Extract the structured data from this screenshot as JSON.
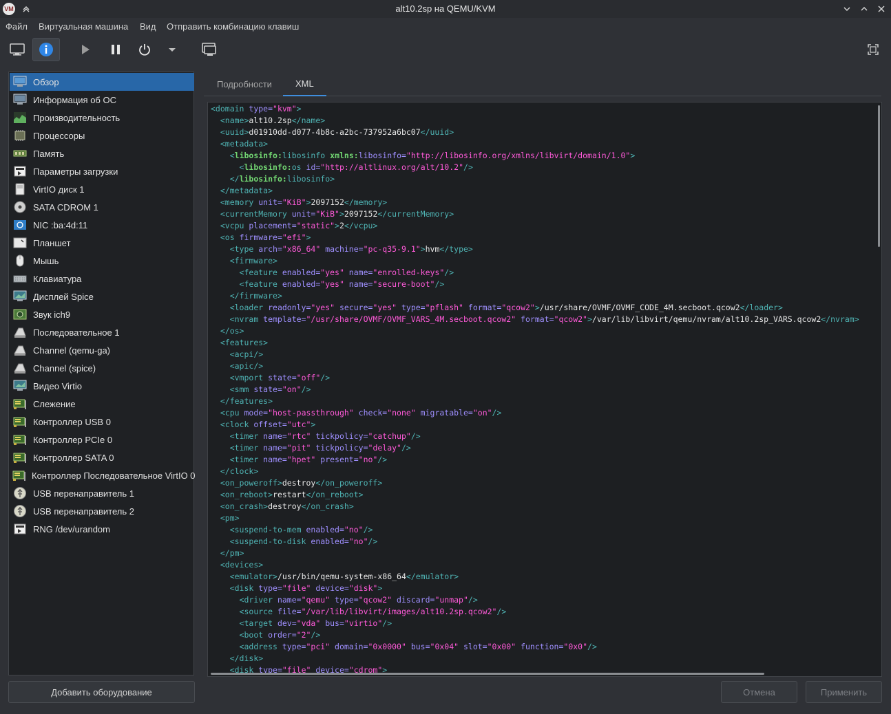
{
  "window": {
    "title": "alt10.2sp на QEMU/KVM",
    "logo_text": "VM"
  },
  "menu": [
    "Файл",
    "Виртуальная машина",
    "Вид",
    "Отправить комбинацию клавиш"
  ],
  "sidebar": {
    "items": [
      {
        "label": "Обзор",
        "icon": "overview-monitor-icon"
      },
      {
        "label": "Информация об ОС",
        "icon": "os-info-icon"
      },
      {
        "label": "Производительность",
        "icon": "performance-chart-icon"
      },
      {
        "label": "Процессоры",
        "icon": "cpu-chip-icon"
      },
      {
        "label": "Память",
        "icon": "memory-module-icon"
      },
      {
        "label": "Параметры загрузки",
        "icon": "boot-options-icon"
      },
      {
        "label": "VirtIO диск 1",
        "icon": "disk-icon"
      },
      {
        "label": "SATA CDROM 1",
        "icon": "cdrom-icon"
      },
      {
        "label": "NIC :ba:4d:11",
        "icon": "network-icon"
      },
      {
        "label": "Планшет",
        "icon": "tablet-icon"
      },
      {
        "label": "Мышь",
        "icon": "mouse-icon"
      },
      {
        "label": "Клавиатура",
        "icon": "keyboard-icon"
      },
      {
        "label": "Дисплей Spice",
        "icon": "display-icon"
      },
      {
        "label": "Звук ich9",
        "icon": "sound-icon"
      },
      {
        "label": "Последовательное 1",
        "icon": "serial-icon"
      },
      {
        "label": "Channel (qemu-ga)",
        "icon": "channel-icon"
      },
      {
        "label": "Channel (spice)",
        "icon": "channel-icon"
      },
      {
        "label": "Видео Virtio",
        "icon": "video-icon"
      },
      {
        "label": "Слежение",
        "icon": "watchdog-card-icon"
      },
      {
        "label": "Контроллер USB 0",
        "icon": "controller-card-icon"
      },
      {
        "label": "Контроллер PCIe 0",
        "icon": "controller-card-icon"
      },
      {
        "label": "Контроллер SATA 0",
        "icon": "controller-card-icon"
      },
      {
        "label": "Контроллер Последовательное VirtIO 0",
        "icon": "controller-card-icon"
      },
      {
        "label": "USB перенаправитель 1",
        "icon": "usb-redirector-icon"
      },
      {
        "label": "USB перенаправитель 2",
        "icon": "usb-redirector-icon"
      },
      {
        "label": "RNG /dev/urandom",
        "icon": "rng-icon"
      }
    ],
    "selected_index": 0
  },
  "buttons": {
    "add_hardware": "Добавить оборудование",
    "cancel": "Отмена",
    "apply": "Применить"
  },
  "tabs": [
    {
      "label": "Подробности",
      "active": false
    },
    {
      "label": "XML",
      "active": true
    }
  ],
  "xml_lines": [
    [
      [
        "t",
        "<domain "
      ],
      [
        "a",
        "type="
      ],
      [
        "v",
        "\"kvm\""
      ],
      [
        "t",
        ">"
      ]
    ],
    [
      [
        "s",
        "  "
      ],
      [
        "t",
        "<name>"
      ],
      [
        "x",
        "alt10.2sp"
      ],
      [
        "t",
        "</name>"
      ]
    ],
    [
      [
        "s",
        "  "
      ],
      [
        "t",
        "<uuid>"
      ],
      [
        "x",
        "d01910dd-d077-4b8c-a2bc-737952a6bc07"
      ],
      [
        "t",
        "</uuid>"
      ]
    ],
    [
      [
        "s",
        "  "
      ],
      [
        "t",
        "<metadata>"
      ]
    ],
    [
      [
        "s",
        "    "
      ],
      [
        "t",
        "<"
      ],
      [
        "n",
        "libosinfo:"
      ],
      [
        "t",
        "libosinfo "
      ],
      [
        "n",
        "xmlns:"
      ],
      [
        "a",
        "libosinfo="
      ],
      [
        "v",
        "\"http://libosinfo.org/xmlns/libvirt/domain/1.0\""
      ],
      [
        "t",
        ">"
      ]
    ],
    [
      [
        "s",
        "      "
      ],
      [
        "t",
        "<"
      ],
      [
        "n",
        "libosinfo:"
      ],
      [
        "t",
        "os "
      ],
      [
        "a",
        "id="
      ],
      [
        "v",
        "\"http://altlinux.org/alt/10.2\""
      ],
      [
        "t",
        "/>"
      ]
    ],
    [
      [
        "s",
        "    "
      ],
      [
        "t",
        "</"
      ],
      [
        "n",
        "libosinfo:"
      ],
      [
        "t",
        "libosinfo>"
      ]
    ],
    [
      [
        "s",
        "  "
      ],
      [
        "t",
        "</metadata>"
      ]
    ],
    [
      [
        "s",
        "  "
      ],
      [
        "t",
        "<memory "
      ],
      [
        "a",
        "unit="
      ],
      [
        "v",
        "\"KiB\""
      ],
      [
        "t",
        ">"
      ],
      [
        "x",
        "2097152"
      ],
      [
        "t",
        "</memory>"
      ]
    ],
    [
      [
        "s",
        "  "
      ],
      [
        "t",
        "<currentMemory "
      ],
      [
        "a",
        "unit="
      ],
      [
        "v",
        "\"KiB\""
      ],
      [
        "t",
        ">"
      ],
      [
        "x",
        "2097152"
      ],
      [
        "t",
        "</currentMemory>"
      ]
    ],
    [
      [
        "s",
        "  "
      ],
      [
        "t",
        "<vcpu "
      ],
      [
        "a",
        "placement="
      ],
      [
        "v",
        "\"static\""
      ],
      [
        "t",
        ">"
      ],
      [
        "x",
        "2"
      ],
      [
        "t",
        "</vcpu>"
      ]
    ],
    [
      [
        "s",
        "  "
      ],
      [
        "t",
        "<os "
      ],
      [
        "a",
        "firmware="
      ],
      [
        "v",
        "\"efi\""
      ],
      [
        "t",
        ">"
      ]
    ],
    [
      [
        "s",
        "    "
      ],
      [
        "t",
        "<type "
      ],
      [
        "a",
        "arch="
      ],
      [
        "v",
        "\"x86_64\""
      ],
      [
        "a",
        " machine="
      ],
      [
        "v",
        "\"pc-q35-9.1\""
      ],
      [
        "t",
        ">"
      ],
      [
        "x",
        "hvm"
      ],
      [
        "t",
        "</type>"
      ]
    ],
    [
      [
        "s",
        "    "
      ],
      [
        "t",
        "<firmware>"
      ]
    ],
    [
      [
        "s",
        "      "
      ],
      [
        "t",
        "<feature "
      ],
      [
        "a",
        "enabled="
      ],
      [
        "v",
        "\"yes\""
      ],
      [
        "a",
        " name="
      ],
      [
        "v",
        "\"enrolled-keys\""
      ],
      [
        "t",
        "/>"
      ]
    ],
    [
      [
        "s",
        "      "
      ],
      [
        "t",
        "<feature "
      ],
      [
        "a",
        "enabled="
      ],
      [
        "v",
        "\"yes\""
      ],
      [
        "a",
        " name="
      ],
      [
        "v",
        "\"secure-boot\""
      ],
      [
        "t",
        "/>"
      ]
    ],
    [
      [
        "s",
        "    "
      ],
      [
        "t",
        "</firmware>"
      ]
    ],
    [
      [
        "s",
        "    "
      ],
      [
        "t",
        "<loader "
      ],
      [
        "a",
        "readonly="
      ],
      [
        "v",
        "\"yes\""
      ],
      [
        "a",
        " secure="
      ],
      [
        "v",
        "\"yes\""
      ],
      [
        "a",
        " type="
      ],
      [
        "v",
        "\"pflash\""
      ],
      [
        "a",
        " format="
      ],
      [
        "v",
        "\"qcow2\""
      ],
      [
        "t",
        ">"
      ],
      [
        "x",
        "/usr/share/OVMF/OVMF_CODE_4M.secboot.qcow2"
      ],
      [
        "t",
        "</loader>"
      ]
    ],
    [
      [
        "s",
        "    "
      ],
      [
        "t",
        "<nvram "
      ],
      [
        "a",
        "template="
      ],
      [
        "v",
        "\"/usr/share/OVMF/OVMF_VARS_4M.secboot.qcow2\""
      ],
      [
        "a",
        " format="
      ],
      [
        "v",
        "\"qcow2\""
      ],
      [
        "t",
        ">"
      ],
      [
        "x",
        "/var/lib/libvirt/qemu/nvram/alt10.2sp_VARS.qcow2"
      ],
      [
        "t",
        "</nvram>"
      ]
    ],
    [
      [
        "s",
        "  "
      ],
      [
        "t",
        "</os>"
      ]
    ],
    [
      [
        "s",
        "  "
      ],
      [
        "t",
        "<features>"
      ]
    ],
    [
      [
        "s",
        "    "
      ],
      [
        "t",
        "<acpi/>"
      ]
    ],
    [
      [
        "s",
        "    "
      ],
      [
        "t",
        "<apic/>"
      ]
    ],
    [
      [
        "s",
        "    "
      ],
      [
        "t",
        "<vmport "
      ],
      [
        "a",
        "state="
      ],
      [
        "v",
        "\"off\""
      ],
      [
        "t",
        "/>"
      ]
    ],
    [
      [
        "s",
        "    "
      ],
      [
        "t",
        "<smm "
      ],
      [
        "a",
        "state="
      ],
      [
        "v",
        "\"on\""
      ],
      [
        "t",
        "/>"
      ]
    ],
    [
      [
        "s",
        "  "
      ],
      [
        "t",
        "</features>"
      ]
    ],
    [
      [
        "s",
        "  "
      ],
      [
        "t",
        "<cpu "
      ],
      [
        "a",
        "mode="
      ],
      [
        "v",
        "\"host-passthrough\""
      ],
      [
        "a",
        " check="
      ],
      [
        "v",
        "\"none\""
      ],
      [
        "a",
        " migratable="
      ],
      [
        "v",
        "\"on\""
      ],
      [
        "t",
        "/>"
      ]
    ],
    [
      [
        "s",
        "  "
      ],
      [
        "t",
        "<clock "
      ],
      [
        "a",
        "offset="
      ],
      [
        "v",
        "\"utc\""
      ],
      [
        "t",
        ">"
      ]
    ],
    [
      [
        "s",
        "    "
      ],
      [
        "t",
        "<timer "
      ],
      [
        "a",
        "name="
      ],
      [
        "v",
        "\"rtc\""
      ],
      [
        "a",
        " tickpolicy="
      ],
      [
        "v",
        "\"catchup\""
      ],
      [
        "t",
        "/>"
      ]
    ],
    [
      [
        "s",
        "    "
      ],
      [
        "t",
        "<timer "
      ],
      [
        "a",
        "name="
      ],
      [
        "v",
        "\"pit\""
      ],
      [
        "a",
        " tickpolicy="
      ],
      [
        "v",
        "\"delay\""
      ],
      [
        "t",
        "/>"
      ]
    ],
    [
      [
        "s",
        "    "
      ],
      [
        "t",
        "<timer "
      ],
      [
        "a",
        "name="
      ],
      [
        "v",
        "\"hpet\""
      ],
      [
        "a",
        " present="
      ],
      [
        "v",
        "\"no\""
      ],
      [
        "t",
        "/>"
      ]
    ],
    [
      [
        "s",
        "  "
      ],
      [
        "t",
        "</clock>"
      ]
    ],
    [
      [
        "s",
        "  "
      ],
      [
        "t",
        "<on_poweroff>"
      ],
      [
        "x",
        "destroy"
      ],
      [
        "t",
        "</on_poweroff>"
      ]
    ],
    [
      [
        "s",
        "  "
      ],
      [
        "t",
        "<on_reboot>"
      ],
      [
        "x",
        "restart"
      ],
      [
        "t",
        "</on_reboot>"
      ]
    ],
    [
      [
        "s",
        "  "
      ],
      [
        "t",
        "<on_crash>"
      ],
      [
        "x",
        "destroy"
      ],
      [
        "t",
        "</on_crash>"
      ]
    ],
    [
      [
        "s",
        "  "
      ],
      [
        "t",
        "<pm>"
      ]
    ],
    [
      [
        "s",
        "    "
      ],
      [
        "t",
        "<suspend-to-mem "
      ],
      [
        "a",
        "enabled="
      ],
      [
        "v",
        "\"no\""
      ],
      [
        "t",
        "/>"
      ]
    ],
    [
      [
        "s",
        "    "
      ],
      [
        "t",
        "<suspend-to-disk "
      ],
      [
        "a",
        "enabled="
      ],
      [
        "v",
        "\"no\""
      ],
      [
        "t",
        "/>"
      ]
    ],
    [
      [
        "s",
        "  "
      ],
      [
        "t",
        "</pm>"
      ]
    ],
    [
      [
        "s",
        "  "
      ],
      [
        "t",
        "<devices>"
      ]
    ],
    [
      [
        "s",
        "    "
      ],
      [
        "t",
        "<emulator>"
      ],
      [
        "x",
        "/usr/bin/qemu-system-x86_64"
      ],
      [
        "t",
        "</emulator>"
      ]
    ],
    [
      [
        "s",
        "    "
      ],
      [
        "t",
        "<disk "
      ],
      [
        "a",
        "type="
      ],
      [
        "v",
        "\"file\""
      ],
      [
        "a",
        " device="
      ],
      [
        "v",
        "\"disk\""
      ],
      [
        "t",
        ">"
      ]
    ],
    [
      [
        "s",
        "      "
      ],
      [
        "t",
        "<driver "
      ],
      [
        "a",
        "name="
      ],
      [
        "v",
        "\"qemu\""
      ],
      [
        "a",
        " type="
      ],
      [
        "v",
        "\"qcow2\""
      ],
      [
        "a",
        " discard="
      ],
      [
        "v",
        "\"unmap\""
      ],
      [
        "t",
        "/>"
      ]
    ],
    [
      [
        "s",
        "      "
      ],
      [
        "t",
        "<source "
      ],
      [
        "a",
        "file="
      ],
      [
        "v",
        "\"/var/lib/libvirt/images/alt10.2sp.qcow2\""
      ],
      [
        "t",
        "/>"
      ]
    ],
    [
      [
        "s",
        "      "
      ],
      [
        "t",
        "<target "
      ],
      [
        "a",
        "dev="
      ],
      [
        "v",
        "\"vda\""
      ],
      [
        "a",
        " bus="
      ],
      [
        "v",
        "\"virtio\""
      ],
      [
        "t",
        "/>"
      ]
    ],
    [
      [
        "s",
        "      "
      ],
      [
        "t",
        "<boot "
      ],
      [
        "a",
        "order="
      ],
      [
        "v",
        "\"2\""
      ],
      [
        "t",
        "/>"
      ]
    ],
    [
      [
        "s",
        "      "
      ],
      [
        "t",
        "<address "
      ],
      [
        "a",
        "type="
      ],
      [
        "v",
        "\"pci\""
      ],
      [
        "a",
        " domain="
      ],
      [
        "v",
        "\"0x0000\""
      ],
      [
        "a",
        " bus="
      ],
      [
        "v",
        "\"0x04\""
      ],
      [
        "a",
        " slot="
      ],
      [
        "v",
        "\"0x00\""
      ],
      [
        "a",
        " function="
      ],
      [
        "v",
        "\"0x0\""
      ],
      [
        "t",
        "/>"
      ]
    ],
    [
      [
        "s",
        "    "
      ],
      [
        "t",
        "</disk>"
      ]
    ],
    [
      [
        "s",
        "    "
      ],
      [
        "t",
        "<disk "
      ],
      [
        "a",
        "type="
      ],
      [
        "v",
        "\"file\""
      ],
      [
        "a",
        " device="
      ],
      [
        "v",
        "\"cdrom\""
      ],
      [
        "t",
        ">"
      ]
    ]
  ]
}
